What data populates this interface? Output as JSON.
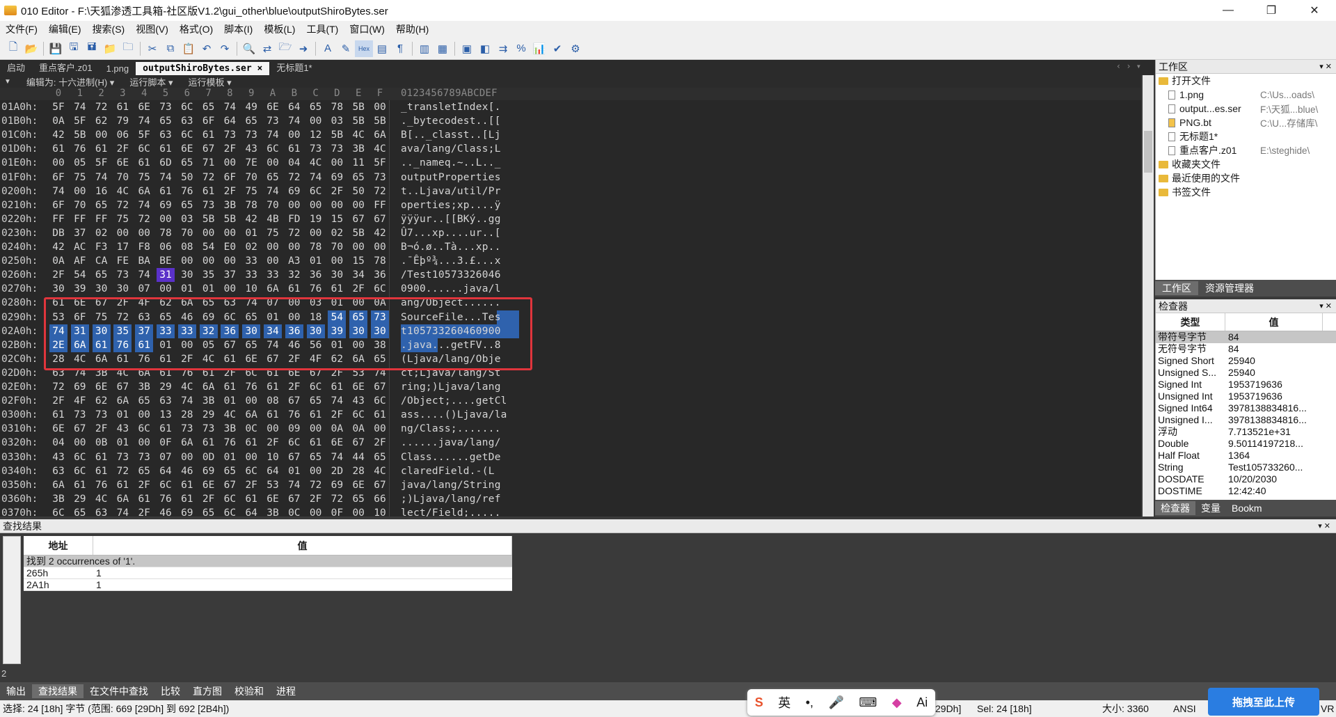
{
  "window": {
    "title": "010 Editor - F:\\天狐渗透工具箱-社区版V1.2\\gui_other\\blue\\outputShiroBytes.ser",
    "minimize": "—",
    "maximize": "❐",
    "close": "✕"
  },
  "menu": [
    "文件(F)",
    "编辑(E)",
    "搜索(S)",
    "视图(V)",
    "格式(O)",
    "脚本(I)",
    "模板(L)",
    "工具(T)",
    "窗口(W)",
    "帮助(H)"
  ],
  "tabs": [
    {
      "label": "启动"
    },
    {
      "label": "重点客户.z01"
    },
    {
      "label": "1.png"
    },
    {
      "label": "outputShiroBytes.ser ×",
      "active": true
    },
    {
      "label": "无标题1*"
    }
  ],
  "tab_nav": "‹ › ▾",
  "editor_bar": {
    "arrow": "▼",
    "encoding": "编辑为: 十六进制(H) ▾",
    "run_script": "运行脚本 ▾",
    "run_template": "运行模板 ▾"
  },
  "hex_header": {
    "cols": [
      "0",
      "1",
      "2",
      "3",
      "4",
      "5",
      "6",
      "7",
      "8",
      "9",
      "A",
      "B",
      "C",
      "D",
      "E",
      "F"
    ],
    "ascii": "0123456789ABCDEF"
  },
  "hex_rows": [
    {
      "addr": "01A0h:",
      "bytes": [
        "5F",
        "74",
        "72",
        "61",
        "6E",
        "73",
        "6C",
        "65",
        "74",
        "49",
        "6E",
        "64",
        "65",
        "78",
        "5B",
        "00"
      ],
      "ascii": "_transletIndex[."
    },
    {
      "addr": "01B0h:",
      "bytes": [
        "0A",
        "5F",
        "62",
        "79",
        "74",
        "65",
        "63",
        "6F",
        "64",
        "65",
        "73",
        "74",
        "00",
        "03",
        "5B",
        "5B"
      ],
      "ascii": "._bytecodest..[["
    },
    {
      "addr": "01C0h:",
      "bytes": [
        "42",
        "5B",
        "00",
        "06",
        "5F",
        "63",
        "6C",
        "61",
        "73",
        "73",
        "74",
        "00",
        "12",
        "5B",
        "4C",
        "6A"
      ],
      "ascii": "B[.._classt..[Lj"
    },
    {
      "addr": "01D0h:",
      "bytes": [
        "61",
        "76",
        "61",
        "2F",
        "6C",
        "61",
        "6E",
        "67",
        "2F",
        "43",
        "6C",
        "61",
        "73",
        "73",
        "3B",
        "4C"
      ],
      "ascii": "ava/lang/Class;L"
    },
    {
      "addr": "01E0h:",
      "bytes": [
        "00",
        "05",
        "5F",
        "6E",
        "61",
        "6D",
        "65",
        "71",
        "00",
        "7E",
        "00",
        "04",
        "4C",
        "00",
        "11",
        "5F"
      ],
      "ascii": ".._nameq.~..L.._"
    },
    {
      "addr": "01F0h:",
      "bytes": [
        "6F",
        "75",
        "74",
        "70",
        "75",
        "74",
        "50",
        "72",
        "6F",
        "70",
        "65",
        "72",
        "74",
        "69",
        "65",
        "73"
      ],
      "ascii": "outputProperties"
    },
    {
      "addr": "0200h:",
      "bytes": [
        "74",
        "00",
        "16",
        "4C",
        "6A",
        "61",
        "76",
        "61",
        "2F",
        "75",
        "74",
        "69",
        "6C",
        "2F",
        "50",
        "72"
      ],
      "ascii": "t..Ljava/util/Pr"
    },
    {
      "addr": "0210h:",
      "bytes": [
        "6F",
        "70",
        "65",
        "72",
        "74",
        "69",
        "65",
        "73",
        "3B",
        "78",
        "70",
        "00",
        "00",
        "00",
        "00",
        "FF"
      ],
      "ascii": "operties;xp....ÿ"
    },
    {
      "addr": "0220h:",
      "bytes": [
        "FF",
        "FF",
        "FF",
        "75",
        "72",
        "00",
        "03",
        "5B",
        "5B",
        "42",
        "4B",
        "FD",
        "19",
        "15",
        "67",
        "67"
      ],
      "ascii": "ÿÿÿur..[[BKý..gg"
    },
    {
      "addr": "0230h:",
      "bytes": [
        "DB",
        "37",
        "02",
        "00",
        "00",
        "78",
        "70",
        "00",
        "00",
        "01",
        "75",
        "72",
        "00",
        "02",
        "5B",
        "42"
      ],
      "ascii": "Û7...xp....ur..["
    },
    {
      "addr": "0240h:",
      "bytes": [
        "42",
        "AC",
        "F3",
        "17",
        "F8",
        "06",
        "08",
        "54",
        "E0",
        "02",
        "00",
        "00",
        "78",
        "70",
        "00",
        "00"
      ],
      "ascii": "B¬ó.ø..Tà...xp.."
    },
    {
      "addr": "0250h:",
      "bytes": [
        "0A",
        "AF",
        "CA",
        "FE",
        "BA",
        "BE",
        "00",
        "00",
        "00",
        "33",
        "00",
        "A3",
        "01",
        "00",
        "15",
        "78"
      ],
      "ascii": ".¯Êþº¾...3.£...x"
    },
    {
      "addr": "0260h:",
      "bytes": [
        "2F",
        "54",
        "65",
        "73",
        "74",
        "31",
        "30",
        "35",
        "37",
        "33",
        "33",
        "32",
        "36",
        "30",
        "34",
        "36"
      ],
      "ascii": "/Test10573326046"
    },
    {
      "addr": "0270h:",
      "bytes": [
        "30",
        "39",
        "30",
        "30",
        "07",
        "00",
        "01",
        "01",
        "00",
        "10",
        "6A",
        "61",
        "76",
        "61",
        "2F",
        "6C"
      ],
      "ascii": "0900......java/l"
    },
    {
      "addr": "0280h:",
      "bytes": [
        "61",
        "6E",
        "67",
        "2F",
        "4F",
        "62",
        "6A",
        "65",
        "63",
        "74",
        "07",
        "00",
        "03",
        "01",
        "00",
        "0A"
      ],
      "ascii": "ang/Object......"
    },
    {
      "addr": "0290h:",
      "bytes": [
        "53",
        "6F",
        "75",
        "72",
        "63",
        "65",
        "46",
        "69",
        "6C",
        "65",
        "01",
        "00",
        "18",
        "54",
        "65",
        "73"
      ],
      "ascii": "SourceFile...Tes"
    },
    {
      "addr": "02A0h:",
      "bytes": [
        "74",
        "31",
        "30",
        "35",
        "37",
        "33",
        "33",
        "32",
        "36",
        "30",
        "34",
        "36",
        "30",
        "39",
        "30",
        "30"
      ],
      "ascii": "t105733260460900"
    },
    {
      "addr": "02B0h:",
      "bytes": [
        "2E",
        "6A",
        "61",
        "76",
        "61",
        "01",
        "00",
        "05",
        "67",
        "65",
        "74",
        "46",
        "56",
        "01",
        "00",
        "38"
      ],
      "ascii": ".java...getFV..8"
    },
    {
      "addr": "02C0h:",
      "bytes": [
        "28",
        "4C",
        "6A",
        "61",
        "76",
        "61",
        "2F",
        "4C",
        "61",
        "6E",
        "67",
        "2F",
        "4F",
        "62",
        "6A",
        "65"
      ],
      "ascii": "(Ljava/lang/Obje"
    },
    {
      "addr": "02D0h:",
      "bytes": [
        "63",
        "74",
        "3B",
        "4C",
        "6A",
        "61",
        "76",
        "61",
        "2F",
        "6C",
        "61",
        "6E",
        "67",
        "2F",
        "53",
        "74"
      ],
      "ascii": "ct;Ljava/lang/St"
    },
    {
      "addr": "02E0h:",
      "bytes": [
        "72",
        "69",
        "6E",
        "67",
        "3B",
        "29",
        "4C",
        "6A",
        "61",
        "76",
        "61",
        "2F",
        "6C",
        "61",
        "6E",
        "67"
      ],
      "ascii": "ring;)Ljava/lang"
    },
    {
      "addr": "02F0h:",
      "bytes": [
        "2F",
        "4F",
        "62",
        "6A",
        "65",
        "63",
        "74",
        "3B",
        "01",
        "00",
        "08",
        "67",
        "65",
        "74",
        "43",
        "6C"
      ],
      "ascii": "/Object;....getCl"
    },
    {
      "addr": "0300h:",
      "bytes": [
        "61",
        "73",
        "73",
        "01",
        "00",
        "13",
        "28",
        "29",
        "4C",
        "6A",
        "61",
        "76",
        "61",
        "2F",
        "6C",
        "61"
      ],
      "ascii": "ass....()Ljava/la"
    },
    {
      "addr": "0310h:",
      "bytes": [
        "6E",
        "67",
        "2F",
        "43",
        "6C",
        "61",
        "73",
        "73",
        "3B",
        "0C",
        "00",
        "09",
        "00",
        "0A",
        "0A",
        "00"
      ],
      "ascii": "ng/Class;......."
    },
    {
      "addr": "0320h:",
      "bytes": [
        "04",
        "00",
        "0B",
        "01",
        "00",
        "0F",
        "6A",
        "61",
        "76",
        "61",
        "2F",
        "6C",
        "61",
        "6E",
        "67",
        "2F"
      ],
      "ascii": "......java/lang/"
    },
    {
      "addr": "0330h:",
      "bytes": [
        "43",
        "6C",
        "61",
        "73",
        "73",
        "07",
        "00",
        "0D",
        "01",
        "00",
        "10",
        "67",
        "65",
        "74",
        "44",
        "65"
      ],
      "ascii": "Class......getDe"
    },
    {
      "addr": "0340h:",
      "bytes": [
        "63",
        "6C",
        "61",
        "72",
        "65",
        "64",
        "46",
        "69",
        "65",
        "6C",
        "64",
        "01",
        "00",
        "2D",
        "28",
        "4C"
      ],
      "ascii": "claredField.-(L"
    },
    {
      "addr": "0350h:",
      "bytes": [
        "6A",
        "61",
        "76",
        "61",
        "2F",
        "6C",
        "61",
        "6E",
        "67",
        "2F",
        "53",
        "74",
        "72",
        "69",
        "6E",
        "67"
      ],
      "ascii": "java/lang/String"
    },
    {
      "addr": "0360h:",
      "bytes": [
        "3B",
        "29",
        "4C",
        "6A",
        "61",
        "76",
        "61",
        "2F",
        "6C",
        "61",
        "6E",
        "67",
        "2F",
        "72",
        "65",
        "66"
      ],
      "ascii": ";)Ljava/lang/ref"
    },
    {
      "addr": "0370h:",
      "bytes": [
        "6C",
        "65",
        "63",
        "74",
        "2F",
        "46",
        "69",
        "65",
        "6C",
        "64",
        "3B",
        "0C",
        "00",
        "0F",
        "00",
        "10"
      ],
      "ascii": "lect/Field;....."
    }
  ],
  "workspace": {
    "title": "工作区",
    "controls": "▾ ✕",
    "open_files_label": "打开文件",
    "files": [
      {
        "name": "1.png",
        "path": "C:\\Us...oads\\"
      },
      {
        "name": "output...es.ser",
        "path": "F:\\天狐...blue\\"
      },
      {
        "name": "PNG.bt",
        "path": "C:\\U...存储库\\"
      },
      {
        "name": "无标题1*",
        "path": ""
      },
      {
        "name": "重点客户.z01",
        "path": "E:\\steghide\\"
      }
    ],
    "favorites": "收藏夹文件",
    "recent": "最近使用的文件",
    "bookmarks": "书签文件",
    "tab_workspace": "工作区",
    "tab_explorer": "资源管理器"
  },
  "inspector": {
    "title": "检查器",
    "controls": "▾ ✕",
    "col_type": "类型",
    "col_value": "值",
    "rows": [
      {
        "type": "带符号字节",
        "value": "84"
      },
      {
        "type": "无符号字节",
        "value": "84"
      },
      {
        "type": "Signed Short",
        "value": "25940"
      },
      {
        "type": "Unsigned S...",
        "value": "25940"
      },
      {
        "type": "Signed Int",
        "value": "1953719636"
      },
      {
        "type": "Unsigned Int",
        "value": "1953719636"
      },
      {
        "type": "Signed Int64",
        "value": "3978138834816..."
      },
      {
        "type": "Unsigned I...",
        "value": "3978138834816..."
      },
      {
        "type": "浮动",
        "value": "7.713521e+31"
      },
      {
        "type": "Double",
        "value": "9.50114197218..."
      },
      {
        "type": "Half Float",
        "value": "1364"
      },
      {
        "type": "String",
        "value": "Test105733260..."
      },
      {
        "type": "DOSDATE",
        "value": "10/20/2030"
      },
      {
        "type": "DOSTIME",
        "value": "12:42:40"
      }
    ],
    "tab_inspector": "检查器",
    "tab_vars": "变量",
    "tab_bookmarks": "Bookm"
  },
  "find": {
    "title": "查找结果",
    "controls": "▾ ✕",
    "col_addr": "地址",
    "col_value": "值",
    "summary": "找到 2 occurrences of '1'.",
    "rows": [
      {
        "addr": "265h",
        "value": "1"
      },
      {
        "addr": "2A1h",
        "value": "1"
      }
    ],
    "left_num": "2"
  },
  "bottom_tabs": [
    "输出",
    "查找结果",
    "在文件中查找",
    "比较",
    "直方图",
    "校验和",
    "进程"
  ],
  "status": {
    "selection": "选择: 24 [18h] 字节 (范围: 669 [29Dh] 到 692 [2B4h])",
    "pos": "29Dh]",
    "sel": "Sel: 24 [18h]",
    "size": "大小: 3360",
    "enc": "ANSI",
    "tail": "VR"
  },
  "ime": {
    "items": [
      "S",
      "英",
      "•,",
      "🎤",
      "⌨",
      "◆",
      "Ai"
    ]
  },
  "upload_label": "拖拽至此上传"
}
